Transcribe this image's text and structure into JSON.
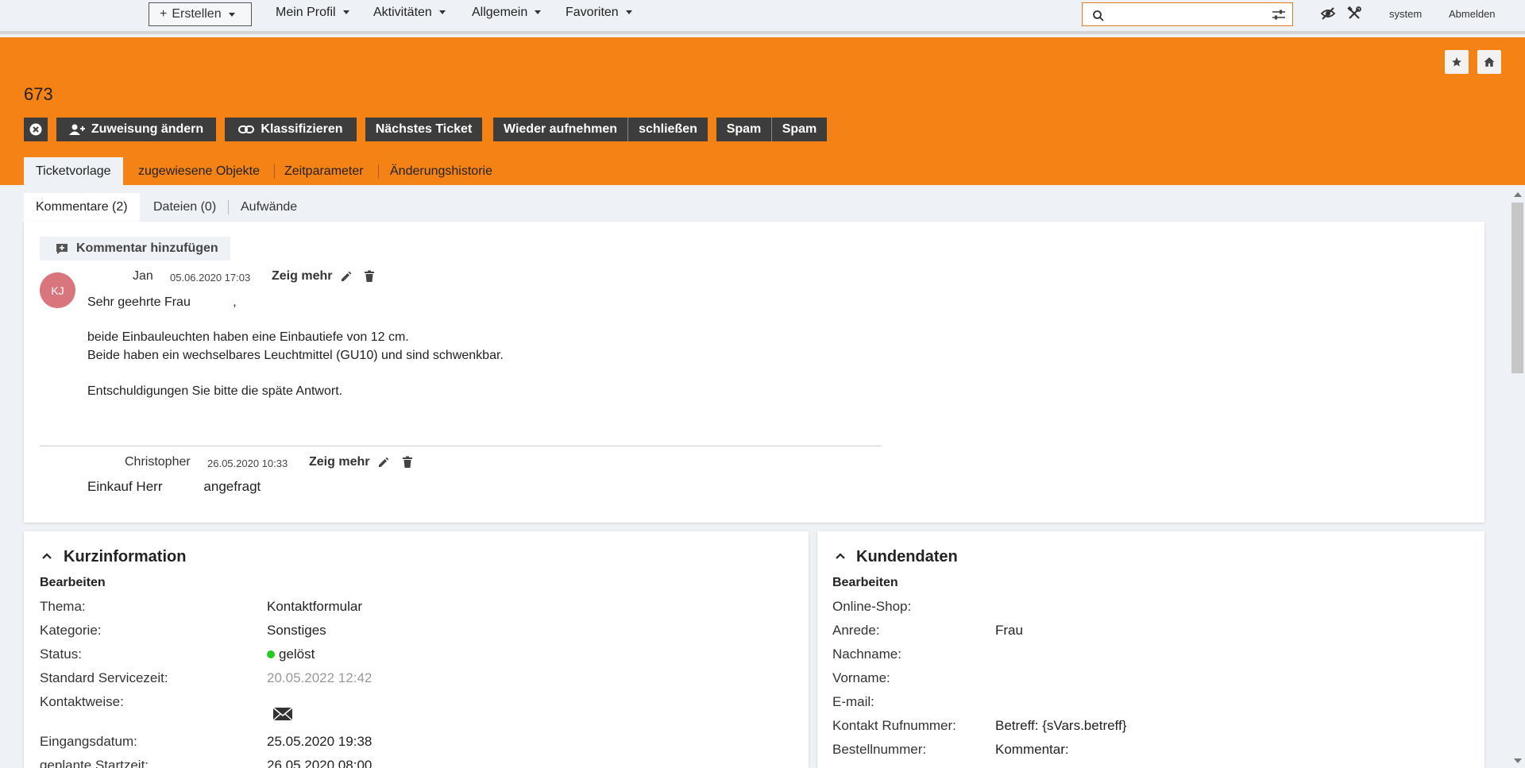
{
  "topbar": {
    "create_label": "Erstellen",
    "nav": [
      "Mein Profil",
      "Aktivitäten",
      "Allgemein",
      "Favoriten"
    ],
    "search_placeholder": "",
    "user": "system",
    "logout": "Abmelden"
  },
  "ticket": {
    "number": "673",
    "actions": {
      "assign": "Zuweisung ändern",
      "classify": "Klassifizieren",
      "next": "Nächstes Ticket",
      "reopen": "Wieder aufnehmen",
      "close": "schließen",
      "spam1": "Spam",
      "spam2": "Spam"
    },
    "tabs": [
      "Ticketvorlage",
      "zugewiesene Objekte",
      "Zeitparameter",
      "Änderungshistorie"
    ]
  },
  "subtabs": [
    "Kommentare (2)",
    "Dateien (0)",
    "Aufwände"
  ],
  "comments": {
    "add_label": "Kommentar hinzufügen",
    "items": [
      {
        "initials": "KJ",
        "author": "Jan",
        "date": "05.06.2020 17:03",
        "more": "Zeig mehr",
        "lines": [
          "Sehr geehrte Frau            ,",
          "",
          "beide Einbauleuchten haben eine Einbautiefe von 12 cm.",
          "Beide haben ein wechselbares Leuchtmittel (GU10) und sind schwenkbar.",
          "",
          "Entschuldigungen Sie bitte die späte Antwort."
        ]
      },
      {
        "author": "Christopher",
        "date": "26.05.2020 10:33",
        "more": "Zeig mehr",
        "lines": [
          "Einkauf Herr           angefragt"
        ]
      }
    ]
  },
  "kurzinfo": {
    "title": "Kurzinformation",
    "edit": "Bearbeiten",
    "fields": [
      {
        "label": "Thema:",
        "value": "Kontaktformular"
      },
      {
        "label": "Kategorie:",
        "value": "Sonstiges"
      },
      {
        "label": "Status:",
        "value": "gelöst",
        "status_color": "#22cc22"
      },
      {
        "label": "Standard Servicezeit:",
        "value": "20.05.2022 12:42"
      },
      {
        "label": "Kontaktweise:",
        "value": "",
        "icon": "mail-icon"
      },
      {
        "label": "Eingangsdatum:",
        "value": "25.05.2020 19:38"
      },
      {
        "label": "geplante Startzeit:",
        "value": "26.05.2020 08:00"
      }
    ]
  },
  "kundendaten": {
    "title": "Kundendaten",
    "edit": "Bearbeiten",
    "fields": [
      {
        "label": "Online-Shop:",
        "value": ""
      },
      {
        "label": "Anrede:",
        "value": "Frau"
      },
      {
        "label": "Nachname:",
        "value": ""
      },
      {
        "label": "Vorname:",
        "value": ""
      },
      {
        "label": "E-mail:",
        "value": ""
      },
      {
        "label": "Kontakt Rufnummer:",
        "value": "Betreff: {sVars.betreff}"
      },
      {
        "label": "Bestellnummer:",
        "value": "Kommentar:"
      }
    ]
  },
  "colors": {
    "accent": "#f48214",
    "button": "#3d3d3d",
    "avatar": "#d9757c"
  }
}
